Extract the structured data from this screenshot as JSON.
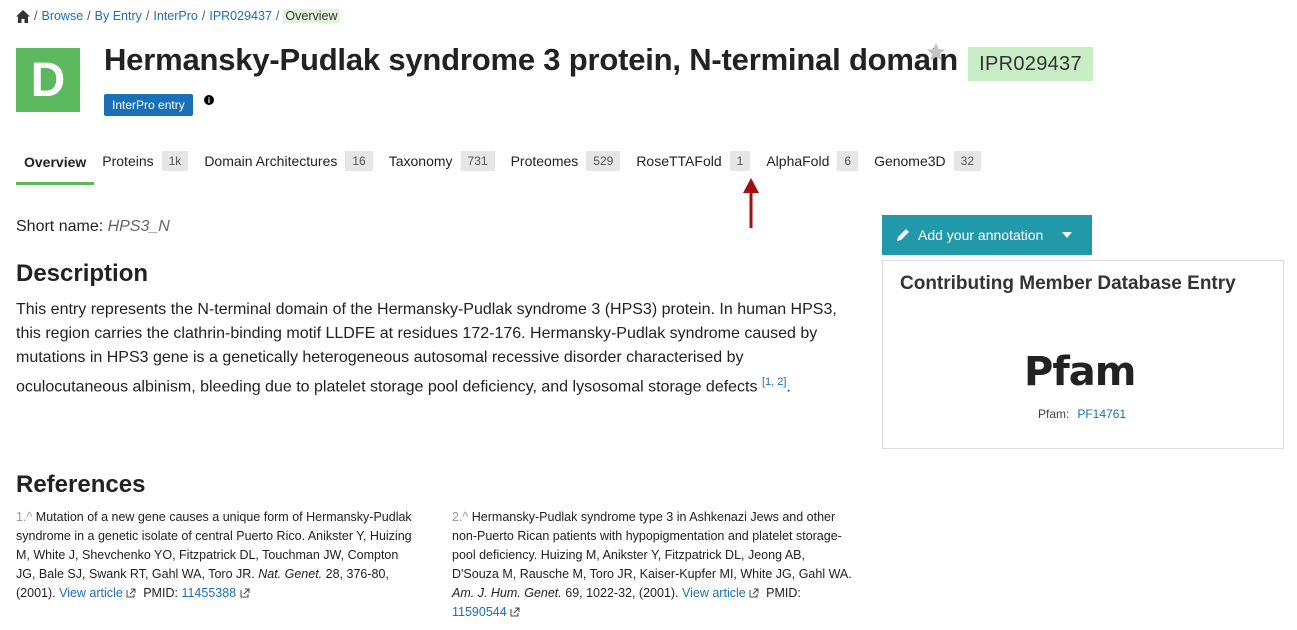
{
  "breadcrumb": {
    "items": [
      "Browse",
      "By Entry",
      "InterPro",
      "IPR029437"
    ],
    "current": "Overview"
  },
  "entry": {
    "type_letter": "D",
    "title": "Hermansky-Pudlak syndrome 3 protein, N-terminal domain",
    "accession": "IPR029437",
    "tag": "InterPro entry",
    "short_name_label": "Short name:",
    "short_name": "HPS3_N"
  },
  "tabs": [
    {
      "label": "Overview",
      "count": ""
    },
    {
      "label": "Proteins",
      "count": "1k"
    },
    {
      "label": "Domain Architectures",
      "count": "16"
    },
    {
      "label": "Taxonomy",
      "count": "731"
    },
    {
      "label": "Proteomes",
      "count": "529"
    },
    {
      "label": "RoseTTAFold",
      "count": "1"
    },
    {
      "label": "AlphaFold",
      "count": "6"
    },
    {
      "label": "Genome3D",
      "count": "32"
    }
  ],
  "description": {
    "heading": "Description",
    "text": "This entry represents the N-terminal domain of the Hermansky-Pudlak syndrome 3 (HPS3) protein. In human HPS3, this region carries the clathrin-binding motif LLDFE at residues 172-176. Hermansky-Pudlak syndrome caused by mutations in HPS3 gene is a genetically heterogeneous autosomal recessive disorder characterised by oculocutaneous albinism, bleeding due to platelet storage pool deficiency, and lysosomal storage defects ",
    "citation": "[1, 2]",
    "end": "."
  },
  "references": {
    "heading": "References",
    "items": [
      {
        "num": "1.^",
        "title": "Mutation of a new gene causes a unique form of Hermansky-Pudlak syndrome in a genetic isolate of central Puerto Rico.",
        "authors": "Anikster Y, Huizing M, White J, Shevchenko YO, Fitzpatrick DL, Touchman JW, Compton JG, Bale SJ, Swank RT, Gahl WA, Toro JR.",
        "journal": "Nat. Genet.",
        "citation": "28, 376-80, (2001).",
        "view_label": "View article",
        "pmid_label": "PMID:",
        "pmid": "11455388"
      },
      {
        "num": "2.^",
        "title": "Hermansky-Pudlak syndrome type 3 in Ashkenazi Jews and other non-Puerto Rican patients with hypopigmentation and platelet storage-pool deficiency.",
        "authors": "Huizing M, Anikster Y, Fitzpatrick DL, Jeong AB, D'Souza M, Rausche M, Toro JR, Kaiser-Kupfer MI, White JG, Gahl WA.",
        "journal": "Am. J. Hum. Genet.",
        "citation": "69, 1022-32, (2001).",
        "view_label": "View article",
        "pmid_label": "PMID:",
        "pmid": "11590544"
      }
    ]
  },
  "sidebar": {
    "annotate_label": "Add your annotation",
    "member_heading": "Contributing Member Database Entry",
    "member_logo": "Pfam",
    "member_db_label": "Pfam:",
    "member_accession": "PF14761"
  },
  "colors": {
    "accent_green": "#5cb85c",
    "accession_bg": "#c8edc4",
    "link_blue": "#1a6fb5",
    "button_teal": "#2199a9",
    "arrow_red": "#a01010"
  }
}
